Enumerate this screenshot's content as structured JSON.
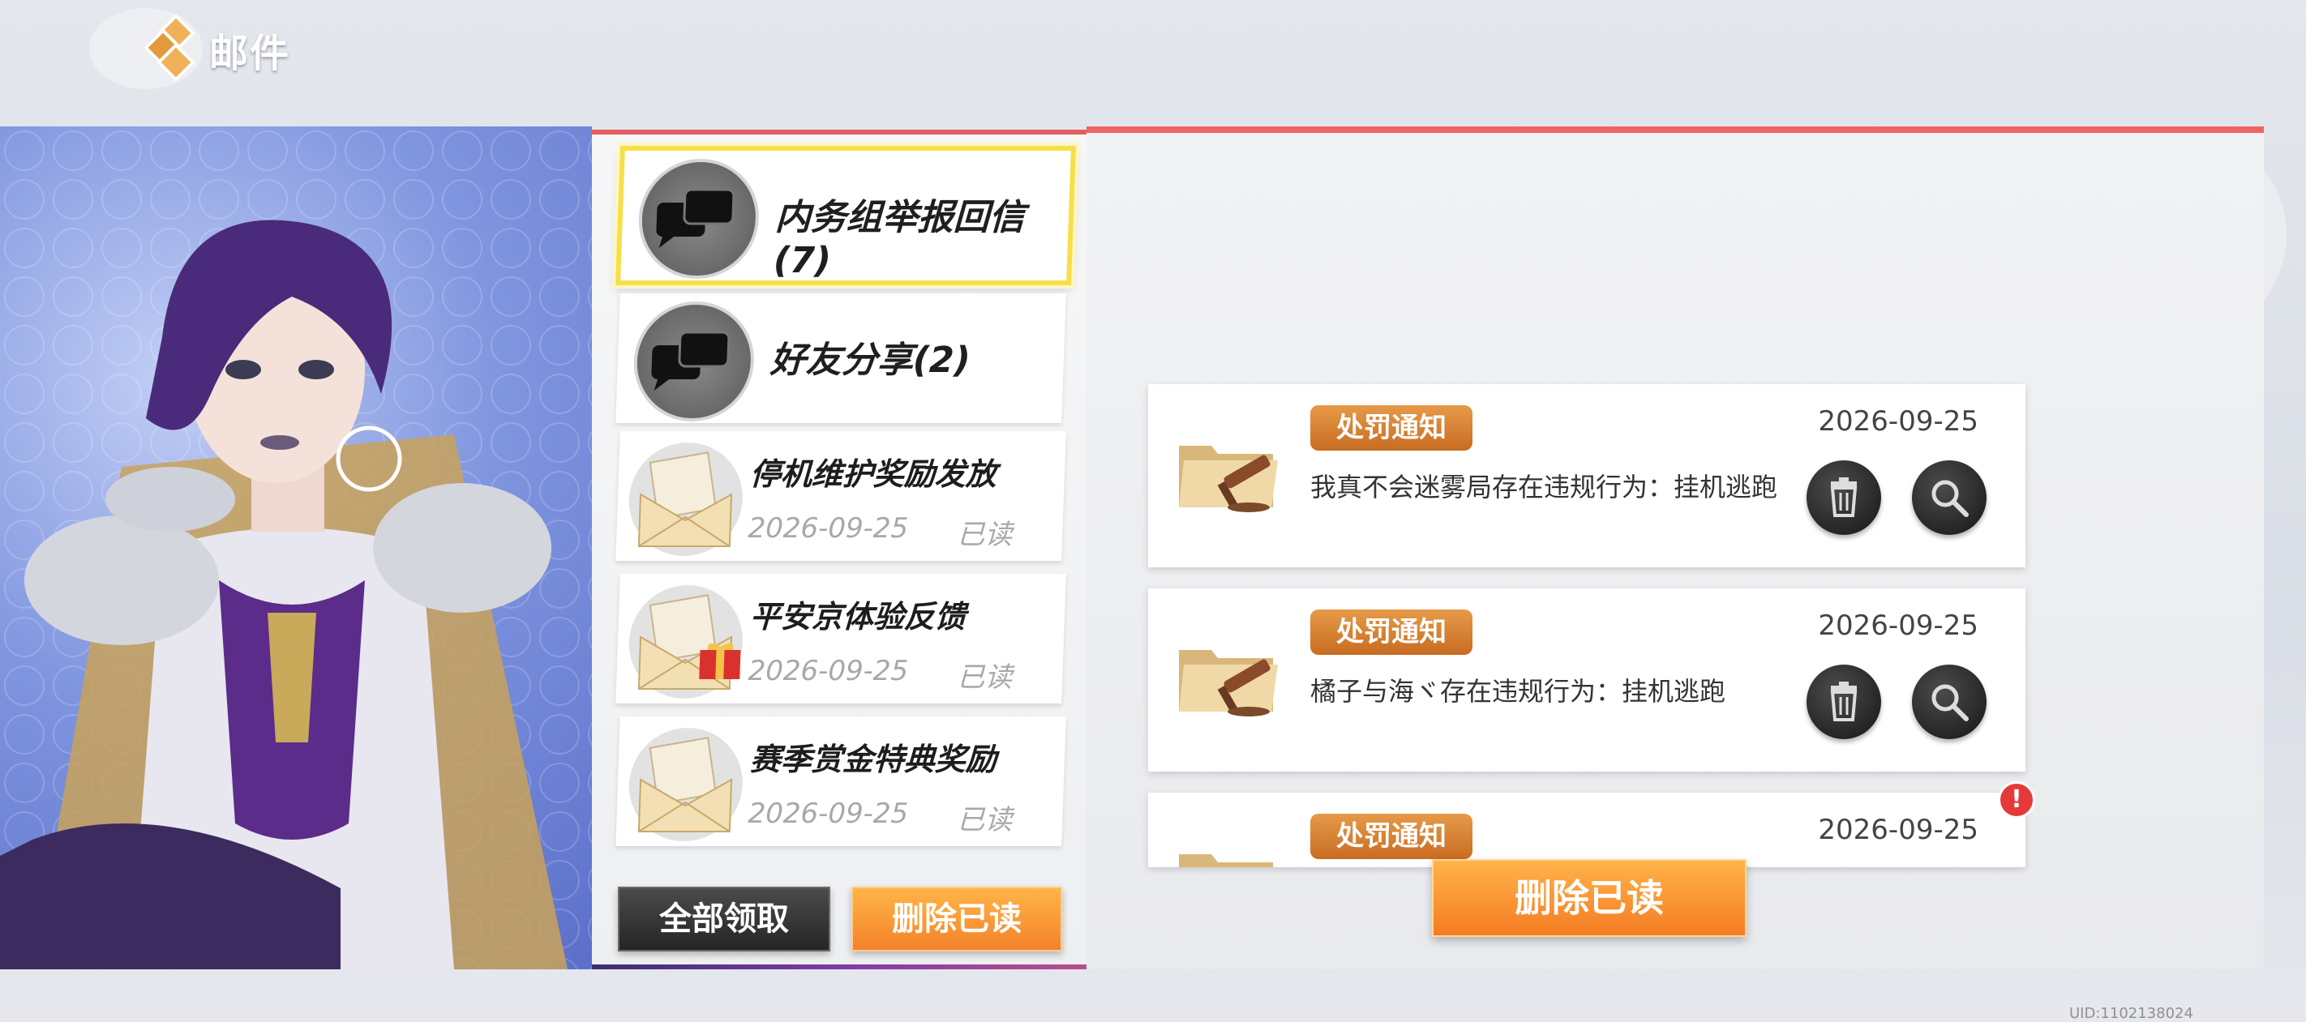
{
  "header": {
    "title": "邮件"
  },
  "mail_list": {
    "categories": [
      {
        "label": "内务组举报回信(7)",
        "selected": true
      },
      {
        "label": "好友分享(2)",
        "selected": false
      }
    ],
    "mails": [
      {
        "subject": "停机维护奖励发放",
        "date": "2026-09-25",
        "status": "已读"
      },
      {
        "subject": "平安京体验反馈",
        "date": "2026-09-25",
        "status": "已读"
      },
      {
        "subject": "赛季赏金特典奖励",
        "date": "2026-09-25",
        "status": "已读"
      }
    ],
    "buttons": {
      "claim_all": "全部领取",
      "delete_read": "删除已读"
    }
  },
  "detail": {
    "notices": [
      {
        "badge": "处罚通知",
        "date": "2026-09-25",
        "text": "我真不会迷雾局存在违规行为：挂机逃跑"
      },
      {
        "badge": "处罚通知",
        "date": "2026-09-25",
        "text": "橘子与海ヾ存在违规行为：挂机逃跑"
      },
      {
        "badge": "处罚通知",
        "date": "2026-09-25",
        "text": "",
        "alert": "!"
      }
    ],
    "delete_read_label": "删除已读"
  },
  "footer": {
    "uid": "UID:1102138024"
  },
  "icons": [
    "diamond-logo-icon",
    "chat-bubbles-icon",
    "envelope-icon",
    "gift-icon",
    "folder-gavel-icon",
    "trash-icon",
    "magnifier-icon",
    "alert-icon"
  ],
  "colors": {
    "accent_orange": "#f3822b",
    "selected_border": "#f7df4a",
    "top_bar_red": "#ee6464"
  }
}
